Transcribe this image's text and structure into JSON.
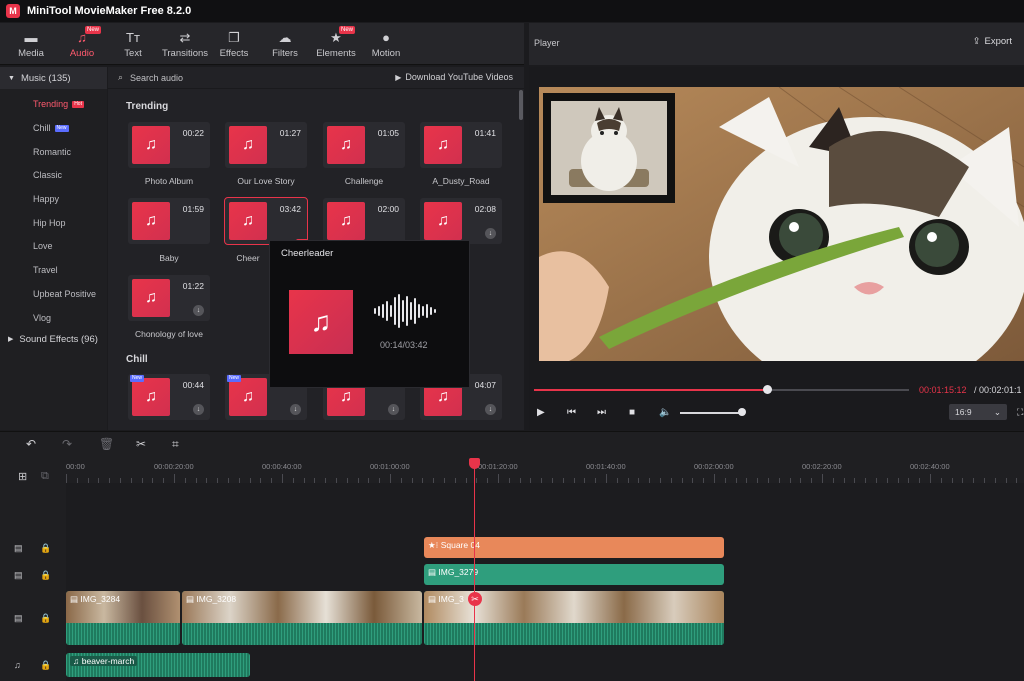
{
  "app": {
    "title": "MiniTool MovieMaker Free 8.2.0",
    "logo_glyph": "M"
  },
  "toolbar": {
    "items": [
      {
        "label": "Media",
        "icon": "folder-icon",
        "glyph": "▬"
      },
      {
        "label": "Audio",
        "icon": "music-icon",
        "glyph": "♫",
        "badge": "New"
      },
      {
        "label": "Text",
        "icon": "text-icon",
        "glyph": "Tт"
      },
      {
        "label": "Transitions",
        "icon": "transitions-icon",
        "glyph": "⇄"
      },
      {
        "label": "Effects",
        "icon": "effects-icon",
        "glyph": "❐"
      },
      {
        "label": "Filters",
        "icon": "filters-icon",
        "glyph": "☁"
      },
      {
        "label": "Elements",
        "icon": "elements-icon",
        "glyph": "★",
        "badge": "New"
      },
      {
        "label": "Motion",
        "icon": "motion-icon",
        "glyph": "●"
      }
    ]
  },
  "categories": {
    "music_header": "Music (135)",
    "items": [
      {
        "label": "Trending",
        "badge": "Hot"
      },
      {
        "label": "Chill",
        "badge": "New"
      },
      {
        "label": "Romantic"
      },
      {
        "label": "Classic"
      },
      {
        "label": "Happy"
      },
      {
        "label": "Hip Hop"
      },
      {
        "label": "Love"
      },
      {
        "label": "Travel"
      },
      {
        "label": "Upbeat Positive"
      },
      {
        "label": "Vlog"
      }
    ],
    "sfx_header": "Sound Effects (96)"
  },
  "library": {
    "search_placeholder": "Search audio",
    "download_label": "Download YouTube Videos",
    "section_trending": "Trending",
    "section_chill": "Chill",
    "tiles": [
      {
        "name": "Photo Album",
        "duration": "00:22"
      },
      {
        "name": "Our Love Story",
        "duration": "01:27"
      },
      {
        "name": "Challenge",
        "duration": "01:05"
      },
      {
        "name": "A_Dusty_Road",
        "duration": "01:41"
      },
      {
        "name": "Baby",
        "duration": "01:59"
      },
      {
        "name": "Cheer",
        "duration": "03:42"
      },
      {
        "name": "",
        "duration": "02:00"
      },
      {
        "name": "",
        "duration": "02:08"
      },
      {
        "name": "Chonology of love",
        "duration": "01:22"
      }
    ],
    "chill_tiles": [
      {
        "duration": "00:44",
        "badge": "New"
      },
      {
        "duration": "",
        "badge": "New"
      },
      {
        "duration": ""
      },
      {
        "duration": "04:07"
      }
    ]
  },
  "preview": {
    "title": "Cheerleader",
    "time": "00:14/03:42"
  },
  "player": {
    "label": "Player",
    "export_label": "Export",
    "current_time": "00:01:15:12",
    "total_time": "/ 00:02:01:1",
    "aspect_ratio": "16:9",
    "progress": 0.62,
    "volume": 0.95
  },
  "timeline": {
    "ruler_labels": [
      "00:00",
      "00:00:20:00",
      "00:00:40:00",
      "00:01:00:00",
      "00:01:20:00",
      "00:01:40:00",
      "00:02:00:00",
      "00:02:20:00",
      "00:02:40:00"
    ],
    "clips": {
      "element": "Square 04",
      "video_overlay": "IMG_3279",
      "main_1": "IMG_3284",
      "main_2": "IMG_3208",
      "main_3": "IMG_3",
      "music": "beaver-march"
    }
  },
  "colors": {
    "accent": "#e8344a",
    "teal": "#2f9e7d",
    "orange": "#e8885a"
  }
}
